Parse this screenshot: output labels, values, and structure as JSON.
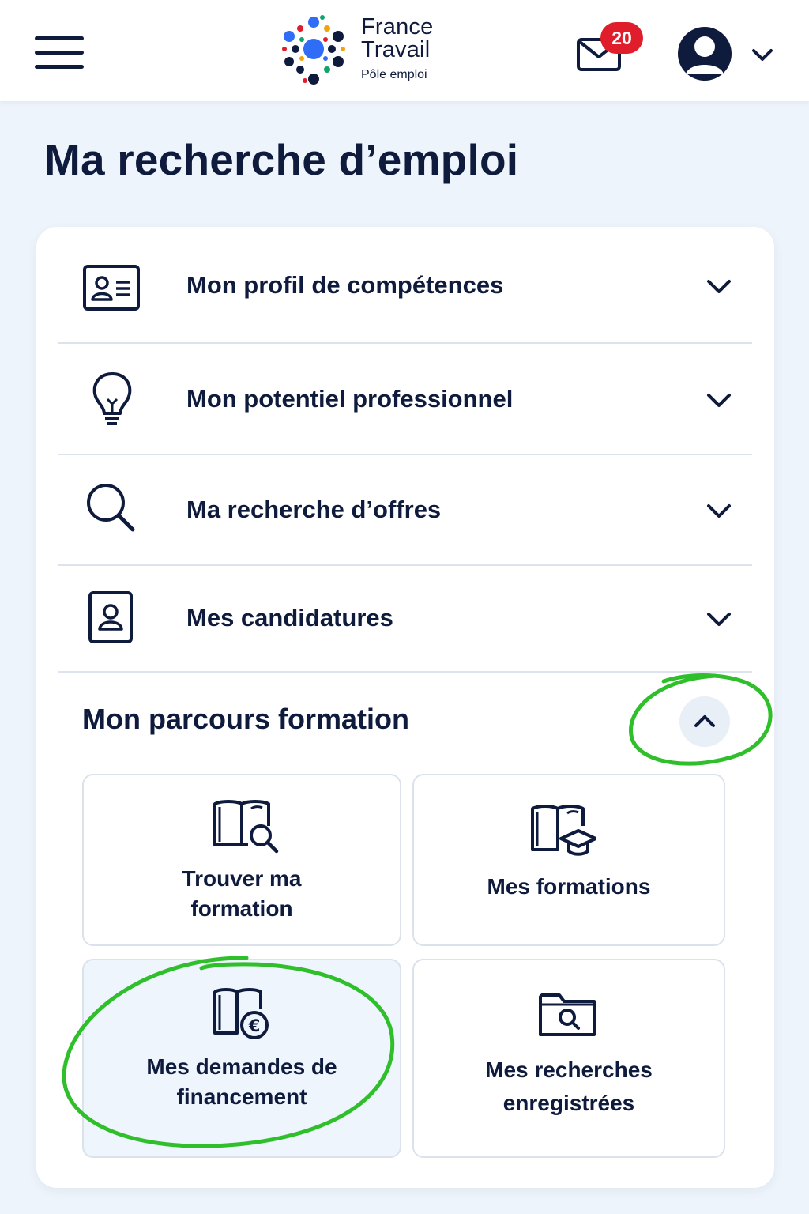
{
  "header": {
    "menu_icon": "hamburger-menu-icon",
    "logo": {
      "line1": "France",
      "line2": "Travail",
      "sub": "Pôle emploi"
    },
    "mail": {
      "icon": "envelope-icon",
      "badge": "20"
    },
    "account": {
      "icon": "user-avatar-icon",
      "caret_icon": "chevron-down-icon"
    }
  },
  "page": {
    "title": "Ma recherche d’emploi"
  },
  "sections": [
    {
      "label": "Mon profil de compétences",
      "icon": "id-card-icon",
      "state": "collapsed"
    },
    {
      "label": "Mon potentiel professionnel",
      "icon": "lightbulb-icon",
      "state": "collapsed"
    },
    {
      "label": "Ma recherche d’offres",
      "icon": "search-icon",
      "state": "collapsed"
    },
    {
      "label": "Mes candidatures",
      "icon": "badge-person-icon",
      "state": "collapsed"
    }
  ],
  "formation": {
    "title": "Mon parcours formation",
    "state": "expanded",
    "toggle_icon": "chevron-up-icon",
    "tiles": [
      {
        "line1": "Trouver ma",
        "line2": "formation",
        "icon": "book-search-icon"
      },
      {
        "line1": "Mes formations",
        "line2": "",
        "icon": "book-graduation-cap-icon"
      },
      {
        "line1": "Mes demandes de",
        "line2": "financement",
        "icon": "book-euro-icon",
        "highlighted": true
      },
      {
        "line1": "Mes recherches",
        "line2": "enregistrées",
        "icon": "folder-search-icon"
      }
    ]
  },
  "colors": {
    "navy": "#0f1b3d",
    "background": "#eef4fb",
    "badge_red": "#e01e2b",
    "annotation_green": "#2fbf2a"
  }
}
